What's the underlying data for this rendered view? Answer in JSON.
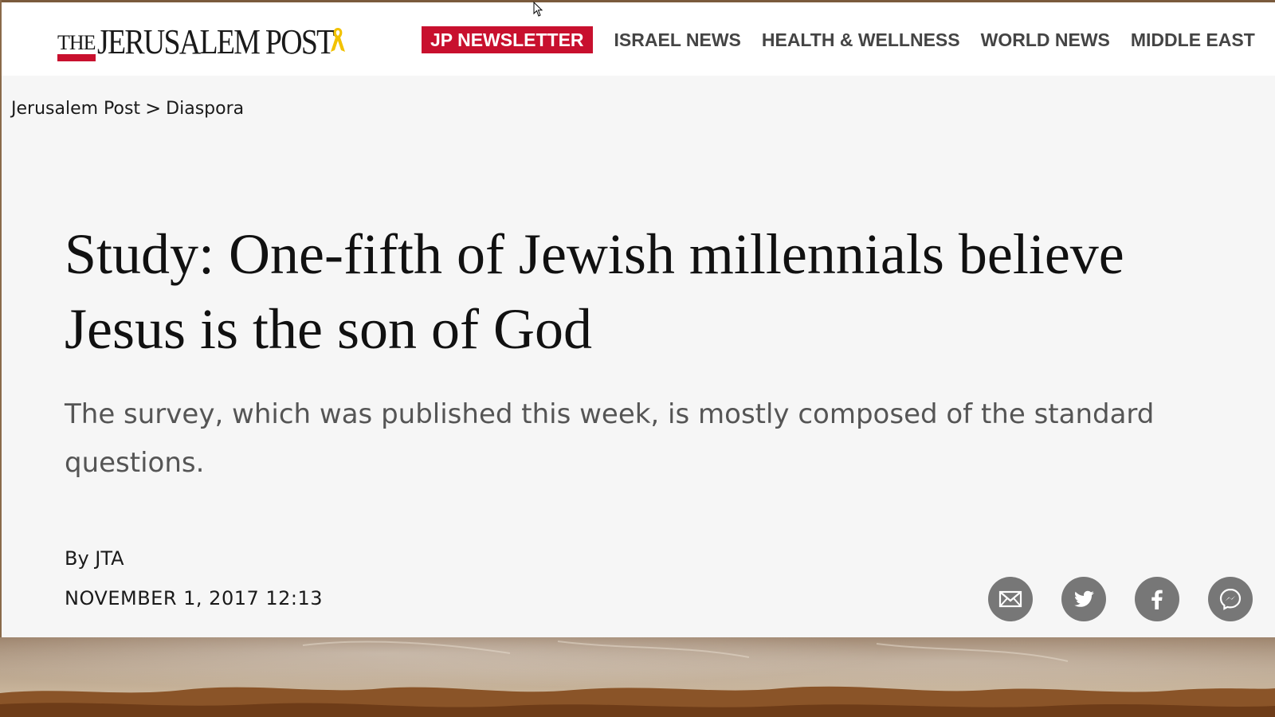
{
  "header": {
    "logo": {
      "the": "THE",
      "name": "JERUSALEM POST"
    },
    "nav": {
      "newsletter": "JP NEWSLETTER",
      "items": [
        "ISRAEL NEWS",
        "HEALTH & WELLNESS",
        "WORLD NEWS",
        "MIDDLE EAST"
      ]
    }
  },
  "breadcrumb": {
    "home": "Jerusalem Post",
    "separator": ">",
    "section": "Diaspora"
  },
  "article": {
    "headline": "Study: One-fifth of Jewish millennials believe Jesus is the son of God",
    "subhead": "The survey, which was published this week, is mostly composed of the standard questions.",
    "byline": "By JTA",
    "date": "NOVEMBER 1, 2017 12:13"
  },
  "share": {
    "icons": [
      "email-icon",
      "twitter-icon",
      "facebook-icon",
      "messenger-icon"
    ]
  },
  "colors": {
    "brand_red": "#c8102e",
    "nav_text": "#444444",
    "share_gray": "#777777",
    "page_bg": "#f6f6f6"
  }
}
